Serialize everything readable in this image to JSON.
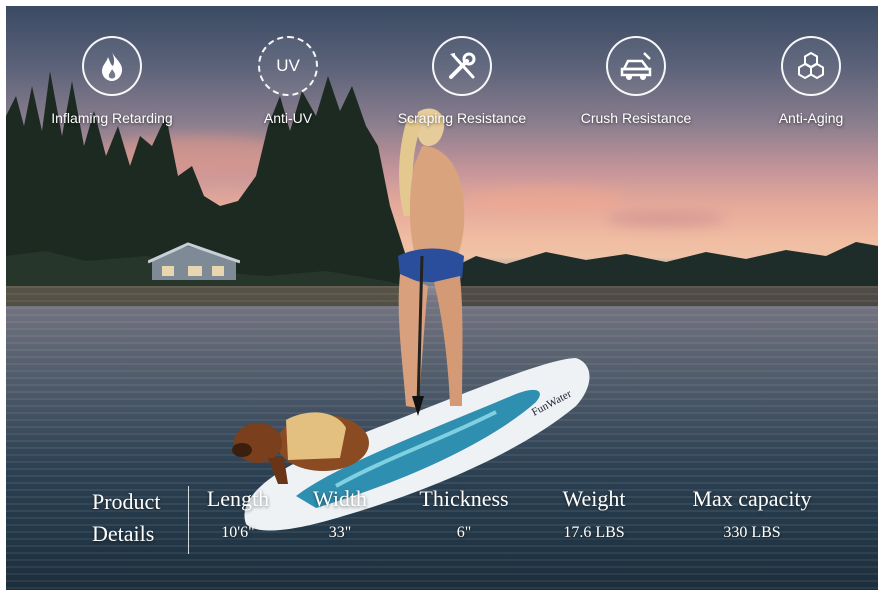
{
  "features": [
    {
      "icon": "flame-icon",
      "label": "Inflaming Retarding"
    },
    {
      "icon": "uv-icon",
      "label": "Anti-UV",
      "icon_text": "UV"
    },
    {
      "icon": "wrench-screwdriver-icon",
      "label": "Scraping Resistance"
    },
    {
      "icon": "car-crush-icon",
      "label": "Crush Resistance"
    },
    {
      "icon": "hexagons-icon",
      "label": "Anti-Aging"
    }
  ],
  "board_brand": "FunWater",
  "product_details": {
    "title_line1": "Product",
    "title_line2": "Details",
    "specs": [
      {
        "name": "Length",
        "value": "10'6\""
      },
      {
        "name": "Width",
        "value": "33\""
      },
      {
        "name": "Thickness",
        "value": "6\""
      },
      {
        "name": "Weight",
        "value": "17.6 LBS"
      },
      {
        "name": "Max capacity",
        "value": "330 LBS"
      }
    ]
  }
}
